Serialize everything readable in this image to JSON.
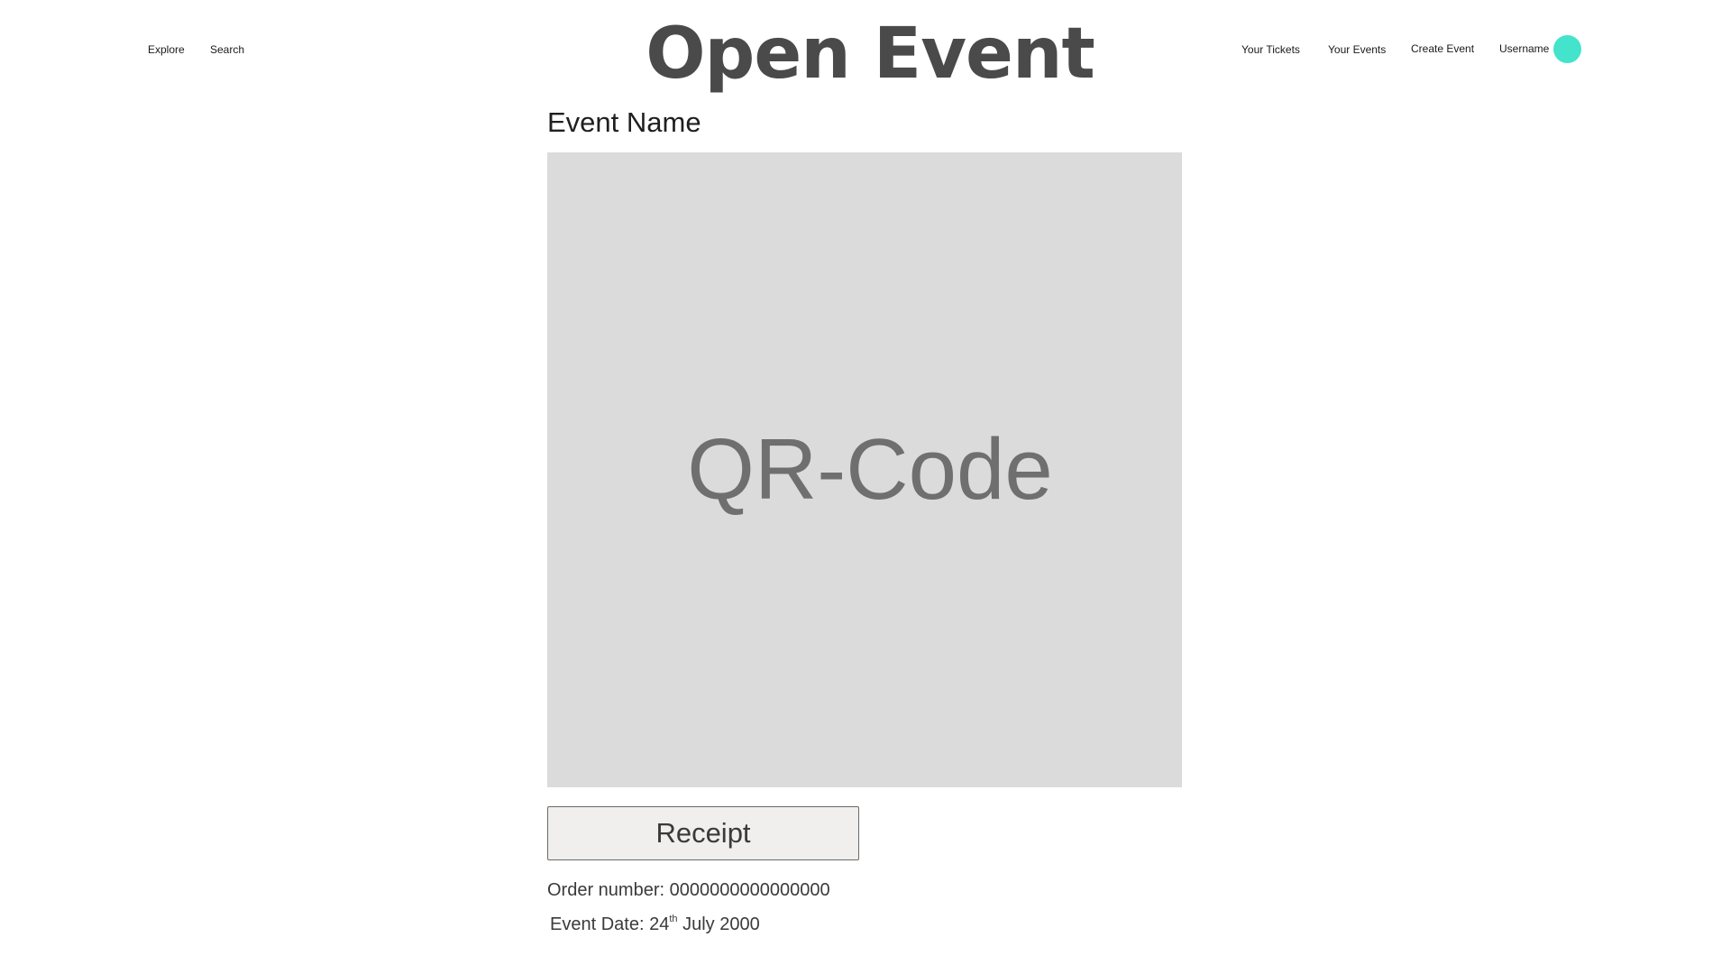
{
  "header": {
    "brand_title": "Open Event",
    "nav_left": {
      "explore": "Explore",
      "search": "Search"
    },
    "nav_right": {
      "your_tickets": "Your Tickets",
      "your_events": "Your Events",
      "create_event": "Create Event",
      "username": "Username"
    },
    "avatar_color": "#44e3cc"
  },
  "ticket": {
    "event_name": "Event Name",
    "qr_placeholder": "QR-Code",
    "receipt_button": "Receipt",
    "order_number_label": "Order number:",
    "order_number_value": "0000000000000000",
    "event_date_label": "Event Date:",
    "event_date_day": "24",
    "event_date_suffix": "th",
    "event_date_rest": "July 2000"
  }
}
